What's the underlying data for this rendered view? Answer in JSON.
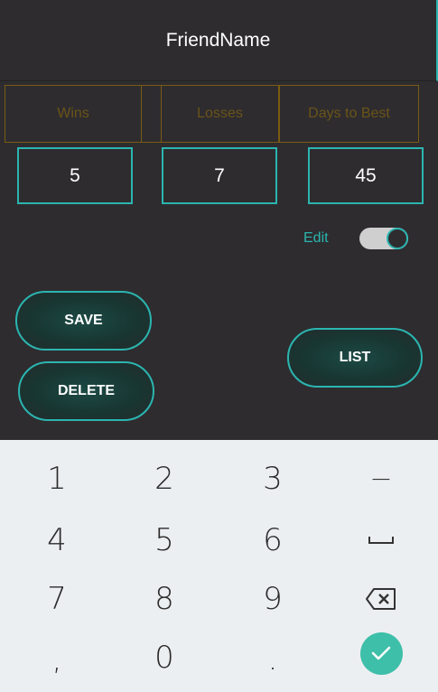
{
  "header": {
    "title": "FriendName"
  },
  "stats": {
    "headers": [
      "Wins",
      "Losses",
      "Days to Best"
    ],
    "values": [
      "5",
      "7",
      "45"
    ]
  },
  "edit": {
    "label": "Edit",
    "toggle_on": true
  },
  "buttons": {
    "save": "SAVE",
    "delete": "DELETE",
    "list": "LIST"
  },
  "keyboard": {
    "rows": [
      [
        "1",
        "2",
        "3",
        "−"
      ],
      [
        "4",
        "5",
        "6",
        "space-icon"
      ],
      [
        "7",
        "8",
        "9",
        "backspace-icon"
      ],
      [
        ",",
        "0",
        ".",
        "check-icon"
      ]
    ]
  },
  "colors": {
    "accent": "#2bb5b0",
    "header_text": "#6b5418",
    "background": "#2e2c2f",
    "done_key": "#3dbfa9"
  }
}
